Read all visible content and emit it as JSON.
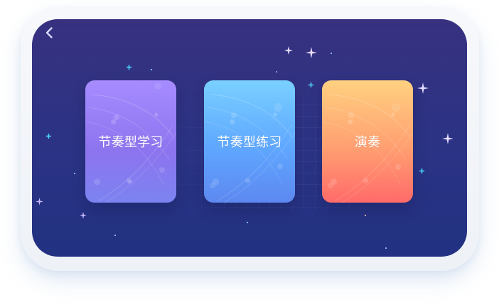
{
  "cards": [
    {
      "label": "节奏型学习"
    },
    {
      "label": "节奏型练习"
    },
    {
      "label": "演奏"
    }
  ],
  "icons": {
    "back": "back-chevron-icon",
    "sparkle": "sparkle-icon"
  },
  "colors": {
    "background": "#2b3385",
    "card_1_top": "#a68cff",
    "card_2_top": "#79d0ff",
    "card_3_top": "#ffd180",
    "accent_cyan": "#4fd8ff"
  }
}
